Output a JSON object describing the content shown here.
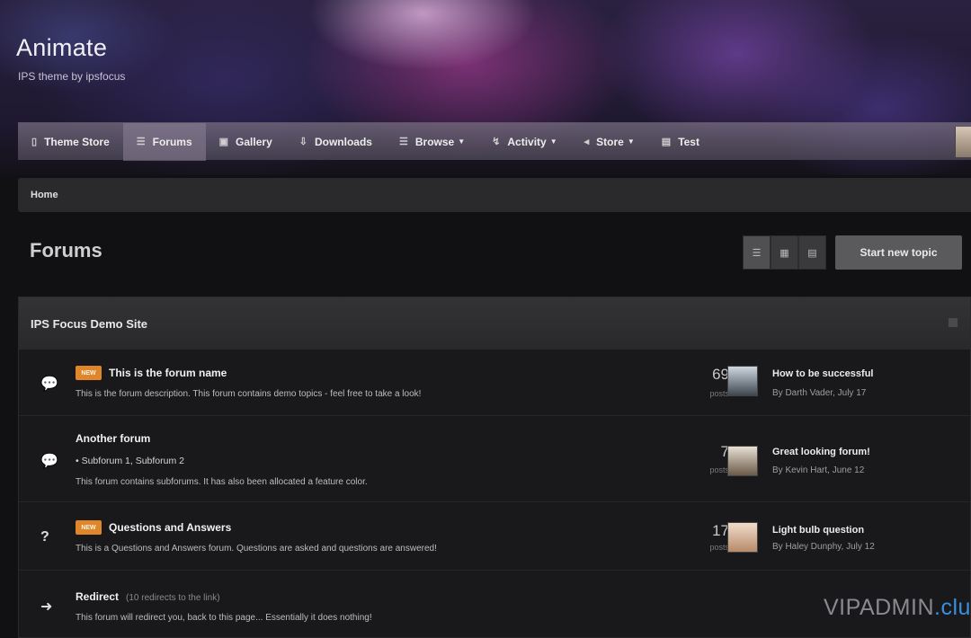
{
  "site": {
    "title": "Animate",
    "tagline": "IPS theme by ipsfocus"
  },
  "nav": {
    "items": [
      {
        "label": "Theme Store",
        "icon": "▯"
      },
      {
        "label": "Forums",
        "icon": "☰"
      },
      {
        "label": "Gallery",
        "icon": "▣"
      },
      {
        "label": "Downloads",
        "icon": "⇩"
      },
      {
        "label": "Browse",
        "icon": "☰"
      },
      {
        "label": "Activity",
        "icon": "↯"
      },
      {
        "label": "Store",
        "icon": "◂"
      },
      {
        "label": "Test",
        "icon": "▤"
      }
    ]
  },
  "breadcrumb": {
    "home": "Home"
  },
  "page": {
    "title": "Forums",
    "new_topic_label": "Start new topic"
  },
  "category": {
    "title": "IPS Focus Demo Site",
    "forums": [
      {
        "name": "This is the forum name",
        "badge": "NEW",
        "description": "This is the forum description. This forum contains demo topics - feel free to take a look!",
        "posts": "69",
        "posts_label": "posts",
        "last_post_title": "How to be successful",
        "last_post_meta": "By Darth Vader, July 17"
      },
      {
        "name": "Another forum",
        "subforums": "• Subforum 1,   Subforum 2",
        "description": "This forum contains subforums. It has also been allocated a feature color.",
        "posts": "7",
        "posts_label": "posts",
        "last_post_title": "Great looking forum!",
        "last_post_meta": "By Kevin Hart, June 12"
      },
      {
        "name": "Questions and Answers",
        "badge": "NEW",
        "description": "This is a Questions and Answers forum. Questions are asked and questions are answered!",
        "posts": "17",
        "posts_label": "posts",
        "last_post_title": "Light bulb question",
        "last_post_meta": "By Haley Dunphy, July 12"
      },
      {
        "name": "Redirect",
        "redirect_note": "(10 redirects to the link)",
        "description": "This forum will redirect you, back to this page... Essentially it does nothing!"
      }
    ]
  },
  "watermark": {
    "text": "VIPADMIN",
    "accent": ".club"
  },
  "colors": {
    "badge": "#e0862a",
    "watermark_accent": "#3b8fe0"
  }
}
